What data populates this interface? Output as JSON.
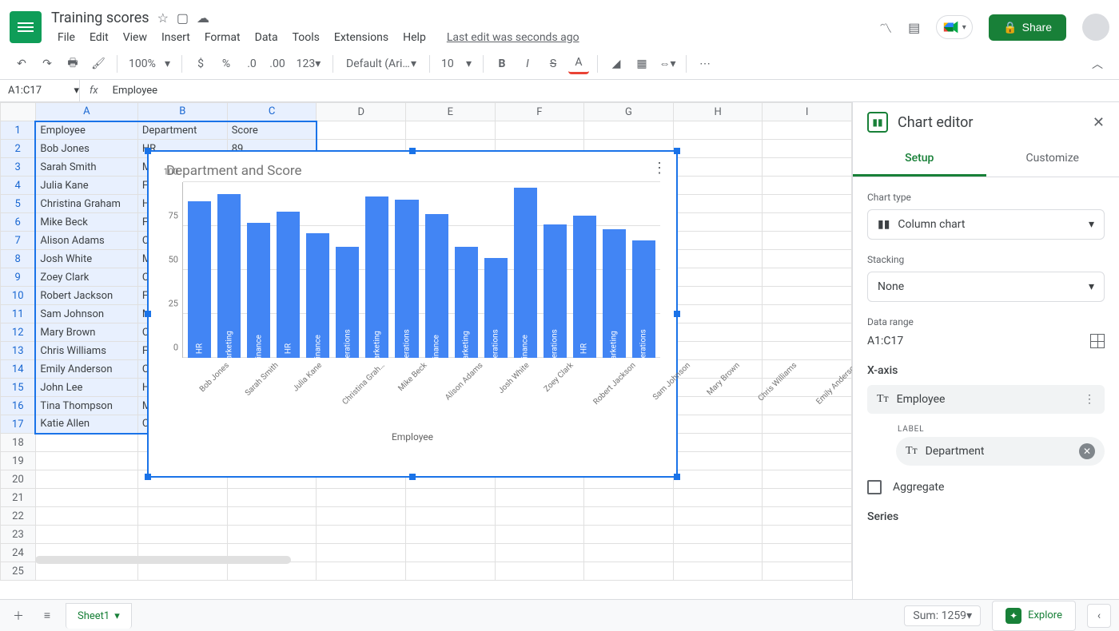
{
  "doc_title": "Training scores",
  "last_edit": "Last edit was seconds ago",
  "menus": [
    "File",
    "Edit",
    "View",
    "Insert",
    "Format",
    "Data",
    "Tools",
    "Extensions",
    "Help"
  ],
  "share": "Share",
  "toolbar": {
    "zoom": "100%",
    "font": "Default (Ari…",
    "size": "10",
    "more": "123"
  },
  "namebox": "A1:C17",
  "formula_hint": "Employee",
  "columns": [
    "A",
    "B",
    "C",
    "D",
    "E",
    "F",
    "G",
    "H",
    "I"
  ],
  "headers": [
    "Employee",
    "Department",
    "Score"
  ],
  "rows": [
    {
      "emp": "Bob Jones",
      "dept": "HR",
      "score": 89
    },
    {
      "emp": "Sarah Smith",
      "dept": "Marketing",
      "score": 93
    },
    {
      "emp": "Julia Kane",
      "dept": "F",
      "score": ""
    },
    {
      "emp": "Christina Graham",
      "dept": "H",
      "score": ""
    },
    {
      "emp": "Mike Beck",
      "dept": "F",
      "score": ""
    },
    {
      "emp": "Alison Adams",
      "dept": "C",
      "score": ""
    },
    {
      "emp": "Josh White",
      "dept": "M",
      "score": ""
    },
    {
      "emp": "Zoey Clark",
      "dept": "C",
      "score": ""
    },
    {
      "emp": "Robert Jackson",
      "dept": "F",
      "score": ""
    },
    {
      "emp": "Sam Johnson",
      "dept": "M",
      "score": ""
    },
    {
      "emp": "Mary Brown",
      "dept": "C",
      "score": ""
    },
    {
      "emp": "Chris Williams",
      "dept": "F",
      "score": ""
    },
    {
      "emp": "Emily Anderson",
      "dept": "C",
      "score": ""
    },
    {
      "emp": "John Lee",
      "dept": "H",
      "score": ""
    },
    {
      "emp": "Tina Thompson",
      "dept": "M",
      "score": ""
    },
    {
      "emp": "Katie Allen",
      "dept": "C",
      "score": ""
    }
  ],
  "chart_data": {
    "type": "bar",
    "title": "Department  and Score",
    "xlabel": "Employee",
    "ylabel": "",
    "ylim": [
      0,
      100
    ],
    "yticks": [
      0,
      25,
      50,
      75,
      100
    ],
    "categories": [
      "Bob Jones",
      "Sarah Smith",
      "Julia Kane",
      "Christina Grah…",
      "Mike Beck",
      "Alison Adams",
      "Josh White",
      "Zoey Clark",
      "Robert Jackson",
      "Sam Johnson",
      "Mary Brown",
      "Chris Williams",
      "Emily Anderson",
      "John Lee",
      "Tina Thompson",
      "Katie Allen"
    ],
    "bar_labels": [
      "HR",
      "Marketing",
      "Finance",
      "HR",
      "Finance",
      "Operations",
      "Marketing",
      "Operations",
      "Finance",
      "Marketing",
      "Operations",
      "Finance",
      "Operations",
      "HR",
      "Marketing",
      "Operations"
    ],
    "values": [
      89,
      93,
      77,
      83,
      71,
      63,
      92,
      90,
      82,
      63,
      57,
      97,
      76,
      81,
      73,
      67
    ]
  },
  "sidebar": {
    "title": "Chart editor",
    "tabs": [
      "Setup",
      "Customize"
    ],
    "chart_type_label": "Chart type",
    "chart_type": "Column chart",
    "stacking_label": "Stacking",
    "stacking": "None",
    "range_label": "Data range",
    "range": "A1:C17",
    "xaxis_label": "X-axis",
    "xaxis_value": "Employee",
    "sub_label": "LABEL",
    "sub_value": "Department",
    "aggregate": "Aggregate",
    "series": "Series"
  },
  "footer": {
    "sheet": "Sheet1",
    "sum": "Sum: 1259",
    "explore": "Explore"
  }
}
